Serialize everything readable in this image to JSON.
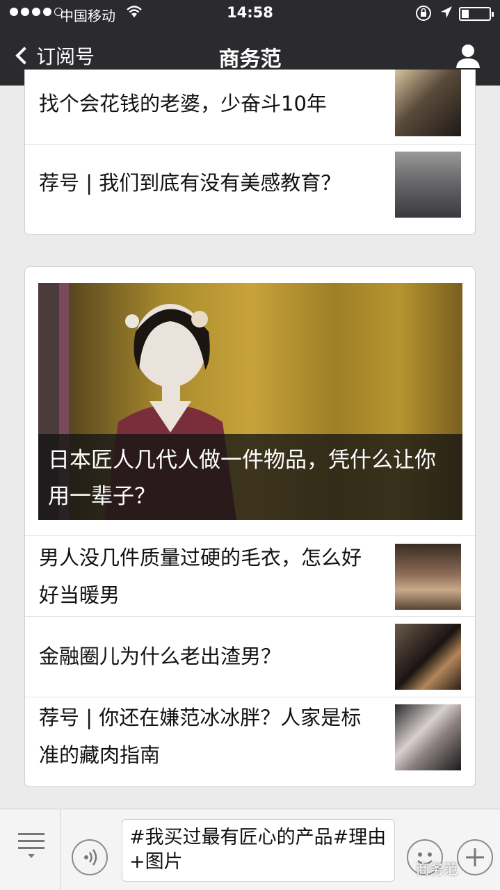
{
  "status_bar": {
    "carrier": "中国移动",
    "time": "14:58"
  },
  "nav": {
    "back_label": "订阅号",
    "title": "商务范"
  },
  "card1": {
    "items": [
      {
        "title": "找个会花钱的老婆，少奋斗10年"
      },
      {
        "title": "荐号 | 我们到底有没有美感教育？"
      }
    ]
  },
  "card2": {
    "hero_title": "日本匠人几代人做一件物品，凭什么让你用一辈子？",
    "items": [
      {
        "title": "男人没几件质量过硬的毛衣，怎么好好当暖男"
      },
      {
        "title": "金融圈儿为什么老出渣男？"
      },
      {
        "title": "荐号 | 你还在嫌范冰冰胖？人家是标准的藏肉指南"
      }
    ]
  },
  "bottom_bar": {
    "input_text": "#我买过最有匠心的产品#理由+图片"
  },
  "watermark": "商务范"
}
